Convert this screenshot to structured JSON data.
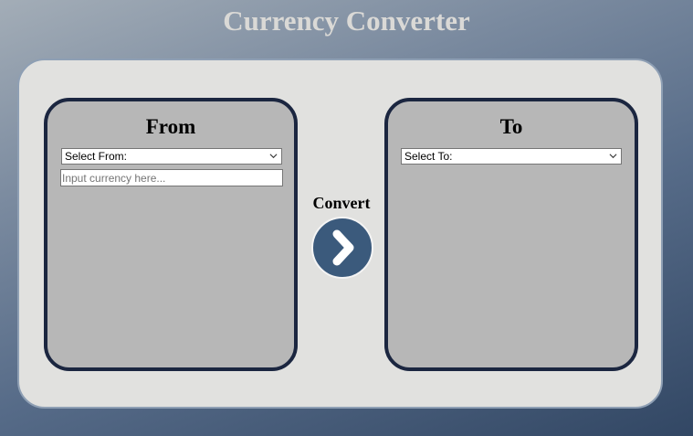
{
  "app": {
    "title": "Currency Converter"
  },
  "from_panel": {
    "heading": "From",
    "select_value": "Select From:",
    "input_placeholder": "Input currency here..."
  },
  "to_panel": {
    "heading": "To",
    "select_value": "Select To:"
  },
  "convert": {
    "label": "Convert",
    "icon": "chevron-right-icon"
  },
  "colors": {
    "panel_border": "#1b2640",
    "panel_fill": "#b7b7b7",
    "card_fill": "#e1e1df",
    "button_fill": "#3b5a7c"
  }
}
